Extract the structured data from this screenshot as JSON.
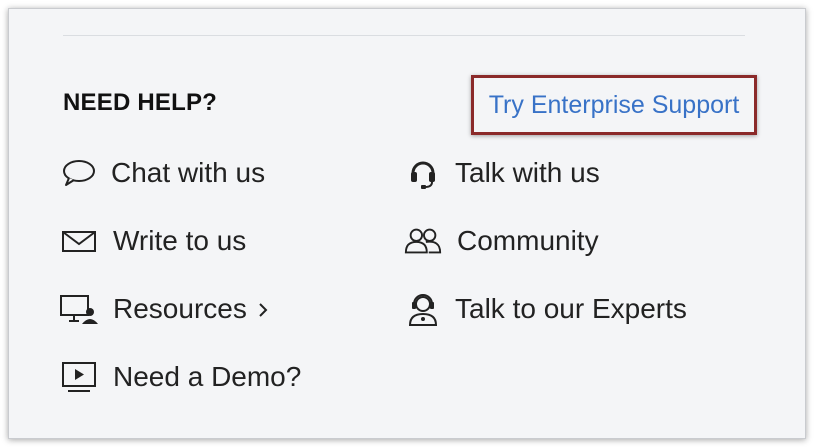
{
  "help": {
    "heading": "NEED HELP?",
    "enterprise_link": "Try Enterprise Support",
    "items_left": [
      {
        "label": "Chat with us",
        "icon": "chat-bubble-icon"
      },
      {
        "label": "Write to us",
        "icon": "envelope-icon"
      },
      {
        "label": "Resources",
        "icon": "monitor-user-icon"
      },
      {
        "label": "Need a Demo?",
        "icon": "play-screen-icon"
      }
    ],
    "items_right": [
      {
        "label": "Talk with us",
        "icon": "headset-icon"
      },
      {
        "label": "Community",
        "icon": "users-icon"
      },
      {
        "label": "Talk to our Experts",
        "icon": "expert-agent-icon"
      }
    ]
  },
  "colors": {
    "panel_bg": "#f4f5f7",
    "link": "#3872c7",
    "highlight_border": "#8b2a2a",
    "text": "#222222"
  }
}
